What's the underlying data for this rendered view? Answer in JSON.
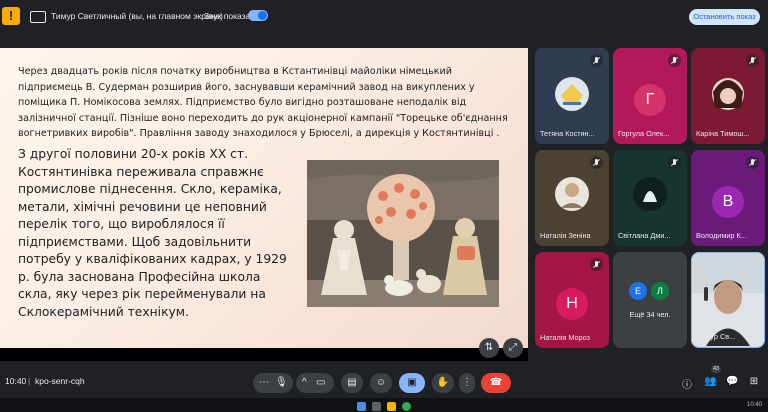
{
  "topbar": {
    "warning_icon": "warning-icon",
    "presenter_text": "Тимур Светличный (вы, на главном экране)",
    "sound_label": "Звук показа",
    "sound_toggle_on": true,
    "stop_button": "Остановить показ"
  },
  "slide": {
    "paragraph1": "Через двадцать років після початку виробництва в Кстантинівці майоліки німецький підприємець В. Судерман розширив його, заснувавши керамічний завод на викуплених у поміщика П. Номікосова землях. Підприємство було вигідно розташоване неподалік від залізничної станції. Пізніше воно переходить до рук акціонерної кампанії \"Торецьке об'єднання вогнетривких виробів\". Правління заводу знаходилося у Брюселі, а дирекція у Костянтинівці .",
    "paragraph2": "З другої половини 20-х років ХХ ст. Костянтинівка переживала справжнє промислове піднесення. Скло, кераміка, метали, хімічні речовини це неповний перелік того, що вироблялося її підприємствами. Щоб задовільнити потребу у кваліфікованих кадрах, у 1929 р. була заснована Професійна школа скла, яку через рік перейменували на Склокерамічний технікум."
  },
  "participants": [
    {
      "name": "Тетяна Костян...",
      "type": "photo",
      "muted": true
    },
    {
      "name": "Горгула Олек...",
      "type": "avatar",
      "letter": "Г",
      "color": "#c2185b",
      "muted": true
    },
    {
      "name": "Каріна Тимош...",
      "type": "photo",
      "muted": true
    },
    {
      "name": "Наталія Зеніна",
      "type": "photo",
      "muted": true
    },
    {
      "name": "Світлана Дми...",
      "type": "photo",
      "muted": true
    },
    {
      "name": "Володимир К...",
      "type": "avatar",
      "letter": "В",
      "color": "#8e24aa",
      "muted": true
    },
    {
      "name": "Наталія Мороз",
      "type": "avatar",
      "letter": "Н",
      "color": "#d81b60",
      "muted": true
    },
    {
      "name": "Ещё 34 чел.",
      "type": "more",
      "letters": [
        "Е",
        "Л"
      ],
      "colors": [
        "#1a73e8",
        "#0b8043"
      ]
    },
    {
      "name": "Тимур Св...",
      "type": "camera",
      "muted": false
    }
  ],
  "bottombar": {
    "time": "10:40",
    "separator": "|",
    "meeting_code": "kpo-senr-cqh",
    "participants_badge": "43"
  },
  "taskbar": {
    "time": "10:40"
  }
}
